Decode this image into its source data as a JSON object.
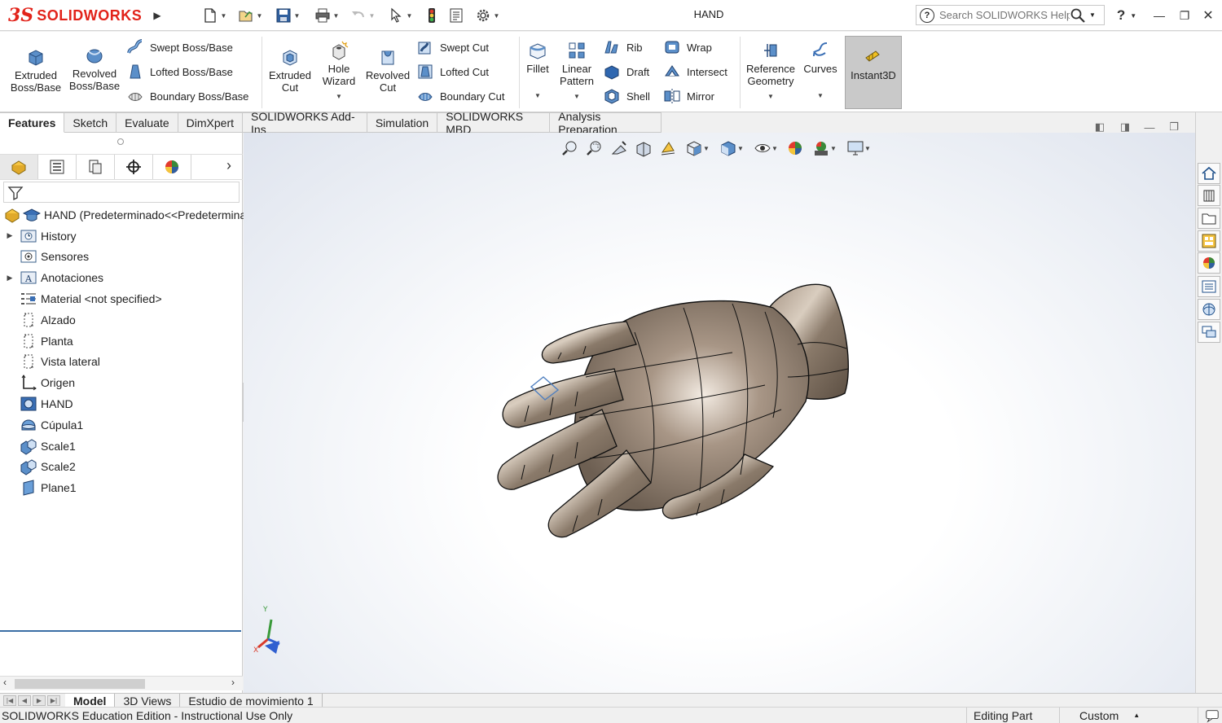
{
  "app": {
    "logo_ds": "3S",
    "logo_text": "SOLIDWORKS",
    "document_title": "HAND",
    "search_placeholder": "Search SOLIDWORKS Help"
  },
  "ribbon": {
    "extruded_boss": "Extruded Boss/Base",
    "revolved_boss": "Revolved Boss/Base",
    "swept_boss": "Swept Boss/Base",
    "lofted_boss": "Lofted Boss/Base",
    "boundary_boss": "Boundary Boss/Base",
    "extruded_cut": "Extruded Cut",
    "hole_wizard": "Hole Wizard",
    "revolved_cut": "Revolved Cut",
    "swept_cut": "Swept Cut",
    "lofted_cut": "Lofted Cut",
    "boundary_cut": "Boundary Cut",
    "fillet": "Fillet",
    "linear_pattern": "Linear Pattern",
    "rib": "Rib",
    "draft": "Draft",
    "shell": "Shell",
    "wrap": "Wrap",
    "intersect": "Intersect",
    "mirror": "Mirror",
    "reference_geometry": "Reference Geometry",
    "curves": "Curves",
    "instant3d": "Instant3D"
  },
  "tabs": [
    "Features",
    "Sketch",
    "Evaluate",
    "DimXpert",
    "SOLIDWORKS Add-Ins",
    "Simulation",
    "SOLIDWORKS MBD",
    "Analysis Preparation"
  ],
  "tree": {
    "root": "HAND  (Predeterminado<<Predeterminado",
    "items": [
      "History",
      "Sensores",
      "Anotaciones",
      "Material <not specified>",
      "Alzado",
      "Planta",
      "Vista lateral",
      "Origen",
      "HAND",
      "Cúpula1",
      "Scale1",
      "Scale2",
      "Plane1"
    ]
  },
  "triad": {
    "y": "Y",
    "x": "X"
  },
  "bottom_tabs": [
    "Model",
    "3D Views",
    "Estudio de movimiento 1"
  ],
  "status": {
    "left": "SOLIDWORKS Education Edition - Instructional Use Only",
    "mode": "Editing Part",
    "units": "Custom"
  },
  "colors": {
    "brand_red": "#e2231a",
    "model_bronze": "#8a7a6a",
    "selection_blue": "#3b6ea5"
  }
}
